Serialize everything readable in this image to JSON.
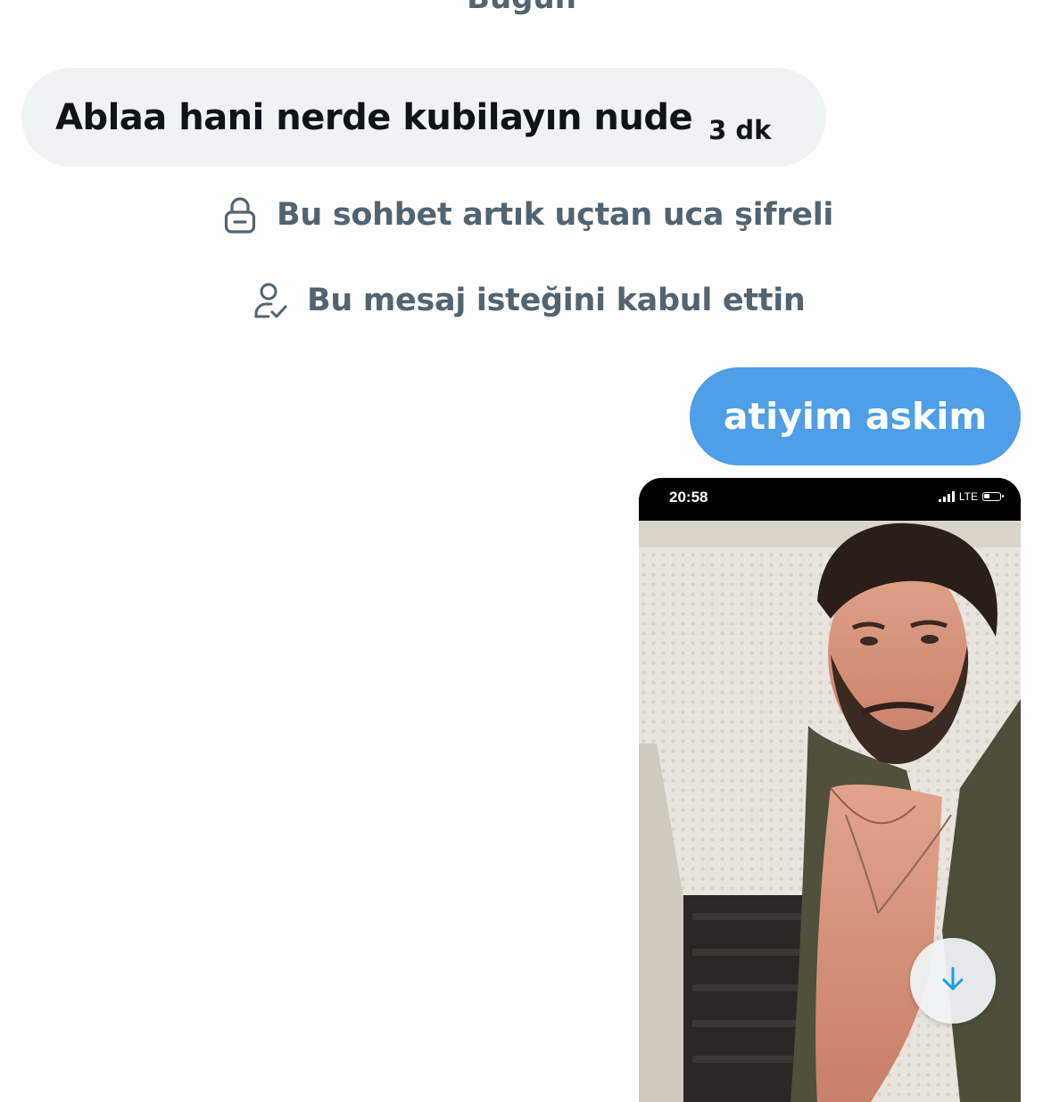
{
  "conversation": {
    "date_separator": "Bugün",
    "incoming": {
      "text": "Ablaa hani nerde kubilayın nude",
      "time": "3 dk"
    },
    "system_messages": {
      "encrypted": "Bu sohbet artık uçtan uca şifreli",
      "accepted": "Bu mesaj isteğini kabul ettin"
    },
    "outgoing": {
      "text": "atiyim askim"
    },
    "image_message": {
      "status_time": "20:58",
      "network": "LTE",
      "icons": [
        "signal-icon",
        "battery-icon"
      ]
    }
  },
  "controls": {
    "scroll_down_icon": "arrow-down-icon"
  },
  "colors": {
    "incoming_bubble": "#eff3f4",
    "outgoing_bubble": "#4e9ee8",
    "system_text": "#536471",
    "accent": "#1d9bf0"
  }
}
